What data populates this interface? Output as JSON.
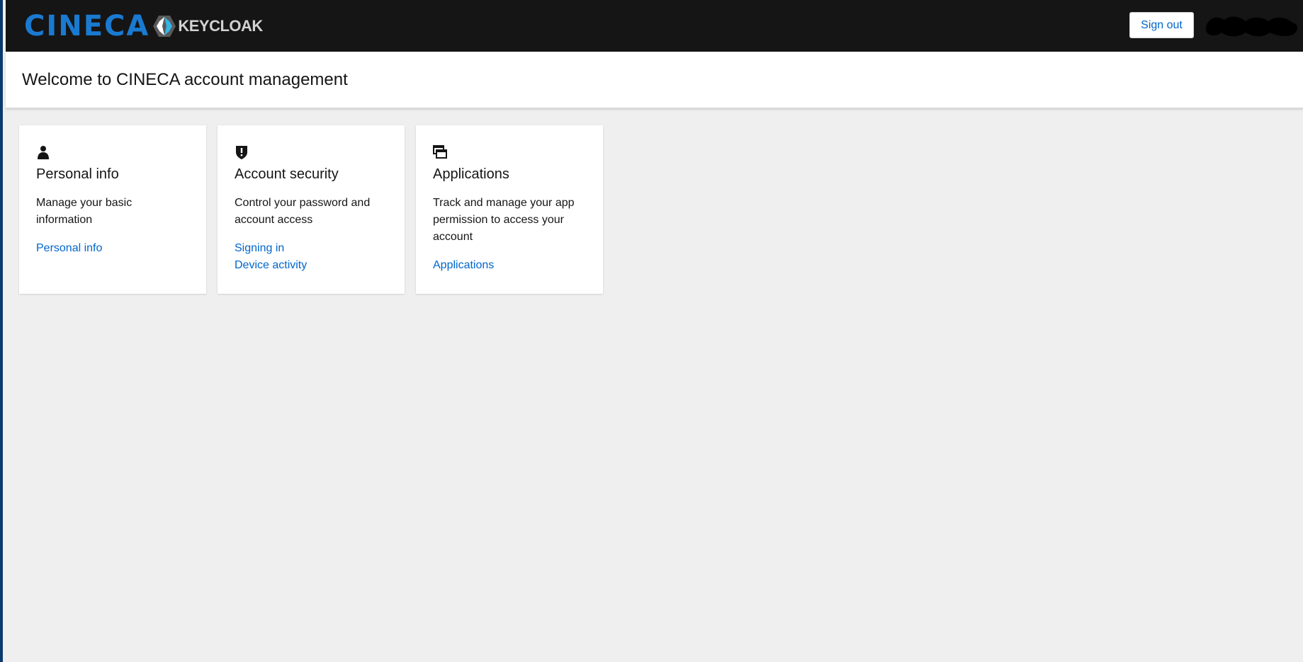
{
  "header": {
    "brand_name": "CINECA",
    "keycloak_label": "KEYCLOAK",
    "signout_label": "Sign out"
  },
  "page": {
    "title": "Welcome to CINECA account management"
  },
  "cards": [
    {
      "icon": "user-icon",
      "title": "Personal info",
      "description": "Manage your basic information",
      "links": [
        "Personal info"
      ]
    },
    {
      "icon": "shield-icon",
      "title": "Account security",
      "description": "Control your password and account access",
      "links": [
        "Signing in",
        "Device activity"
      ]
    },
    {
      "icon": "windows-icon",
      "title": "Applications",
      "description": "Track and manage your app permission to access your account",
      "links": [
        "Applications"
      ]
    }
  ],
  "colors": {
    "masthead_bg": "#151515",
    "brand_blue": "#1a7ad1",
    "link_blue": "#0066cc",
    "page_bg": "#efefef"
  }
}
